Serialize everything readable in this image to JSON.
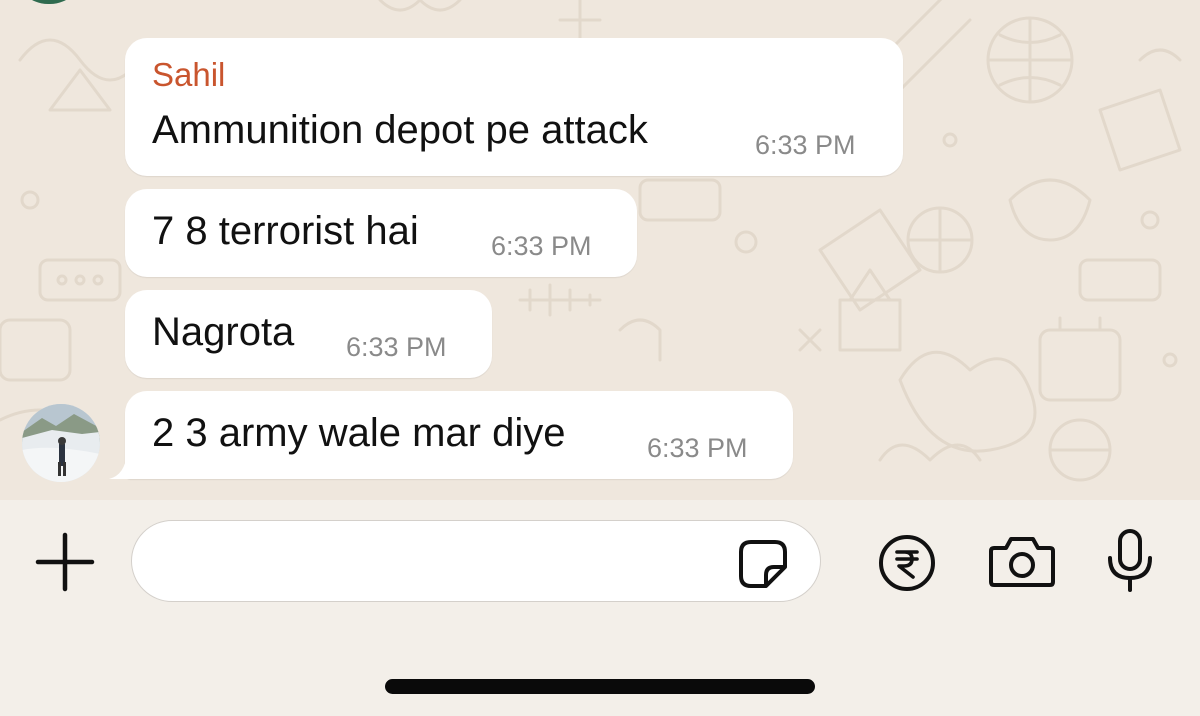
{
  "messages": [
    {
      "sender": "Sahil",
      "text": "Ammunition depot pe attack",
      "time": "6:33 PM"
    },
    {
      "text": "7 8 terrorist hai",
      "time": "6:33 PM"
    },
    {
      "text": "Nagrota",
      "time": "6:33 PM"
    },
    {
      "text": "2 3 army wale mar diye",
      "time": "6:33 PM"
    }
  ],
  "composer": {
    "placeholder": "",
    "value": ""
  },
  "colors": {
    "sender_name": "#c9552e",
    "bubble": "#ffffff",
    "wallpaper": "#efe7dd",
    "timestamp": "#8a8a8a"
  },
  "icons": {
    "add": "plus-icon",
    "sticker": "sticker-icon",
    "payment": "rupee-icon",
    "camera": "camera-icon",
    "voice": "microphone-icon"
  }
}
